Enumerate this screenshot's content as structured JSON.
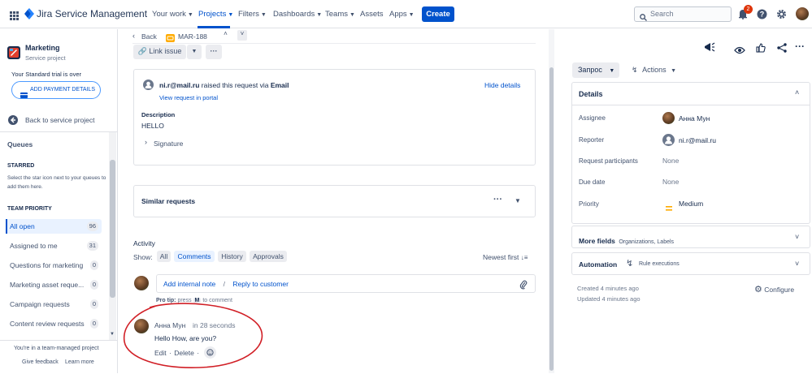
{
  "topbar": {
    "product_name": "Jira Service Management",
    "nav": [
      "Your work",
      "Projects",
      "Filters",
      "Dashboards",
      "Teams",
      "Assets",
      "Apps"
    ],
    "create_label": "Create",
    "search_placeholder": "Search",
    "notification_count": "2"
  },
  "sidebar": {
    "project_name": "Marketing",
    "project_type": "Service project",
    "trial_text": "Your Standard trial is over",
    "add_payment_label": "ADD PAYMENT DETAILS",
    "back_label": "Back to service project",
    "queues_heading": "Queues",
    "starred_heading": "STARRED",
    "starred_hint": "Select the star icon next to your queues to add them here.",
    "team_priority_heading": "TEAM PRIORITY",
    "queues": [
      {
        "label": "All open",
        "count": "96"
      },
      {
        "label": "Assigned to me",
        "count": "31"
      },
      {
        "label": "Questions for marketing",
        "count": "0"
      },
      {
        "label": "Marketing asset reque...",
        "count": "0"
      },
      {
        "label": "Campaign requests",
        "count": "0"
      },
      {
        "label": "Content review requests",
        "count": "0"
      }
    ],
    "footer_text": "You're in a team-managed project",
    "give_feedback": "Give feedback",
    "learn_more": "Learn more"
  },
  "issue": {
    "back_label": "Back",
    "key": "MAR-188",
    "link_issue_label": "Link issue",
    "requester": "ni.r@mail.ru",
    "raised_text": "raised this request via",
    "channel": "Email",
    "hide_details": "Hide details",
    "view_portal": "View request in portal",
    "description_label": "Description",
    "description_value": "HELLO",
    "signature_label": "Signature",
    "similar_requests": "Similar requests",
    "activity_heading": "Activity",
    "show_label": "Show:",
    "filters": [
      "All",
      "Comments",
      "History",
      "Approvals"
    ],
    "sort_label": "Newest first",
    "add_internal_note": "Add internal note",
    "separator": "/",
    "reply_to_customer": "Reply to customer",
    "pro_tip": "Pro tip:",
    "pro_tip_press": "press",
    "pro_tip_key": "M",
    "pro_tip_suffix": "to comment",
    "comment": {
      "author": "Анна Мун",
      "time": "in 28 seconds",
      "body": "Hello How, are you?",
      "edit": "Edit",
      "dot": "·",
      "delete": "Delete"
    }
  },
  "right_panel": {
    "status_label": "Запрос",
    "actions_label": "Actions",
    "details_heading": "Details",
    "fields": [
      {
        "label": "Assignee",
        "value": "Анна Мун"
      },
      {
        "label": "Reporter",
        "value": "ni.r@mail.ru"
      },
      {
        "label": "Request participants",
        "value": "None"
      },
      {
        "label": "Due date",
        "value": "None"
      },
      {
        "label": "Priority",
        "value": "Medium"
      }
    ],
    "more_fields": "More fields",
    "more_fields_hint": "Organizations, Labels",
    "automation": "Automation",
    "automation_hint": "Rule executions",
    "created": "Created 4 minutes ago",
    "updated": "Updated 4 minutes ago",
    "configure": "Configure"
  },
  "colors": {
    "brand": "#0052cc",
    "annotation": "#d11f26",
    "priority": "#ffab00"
  }
}
